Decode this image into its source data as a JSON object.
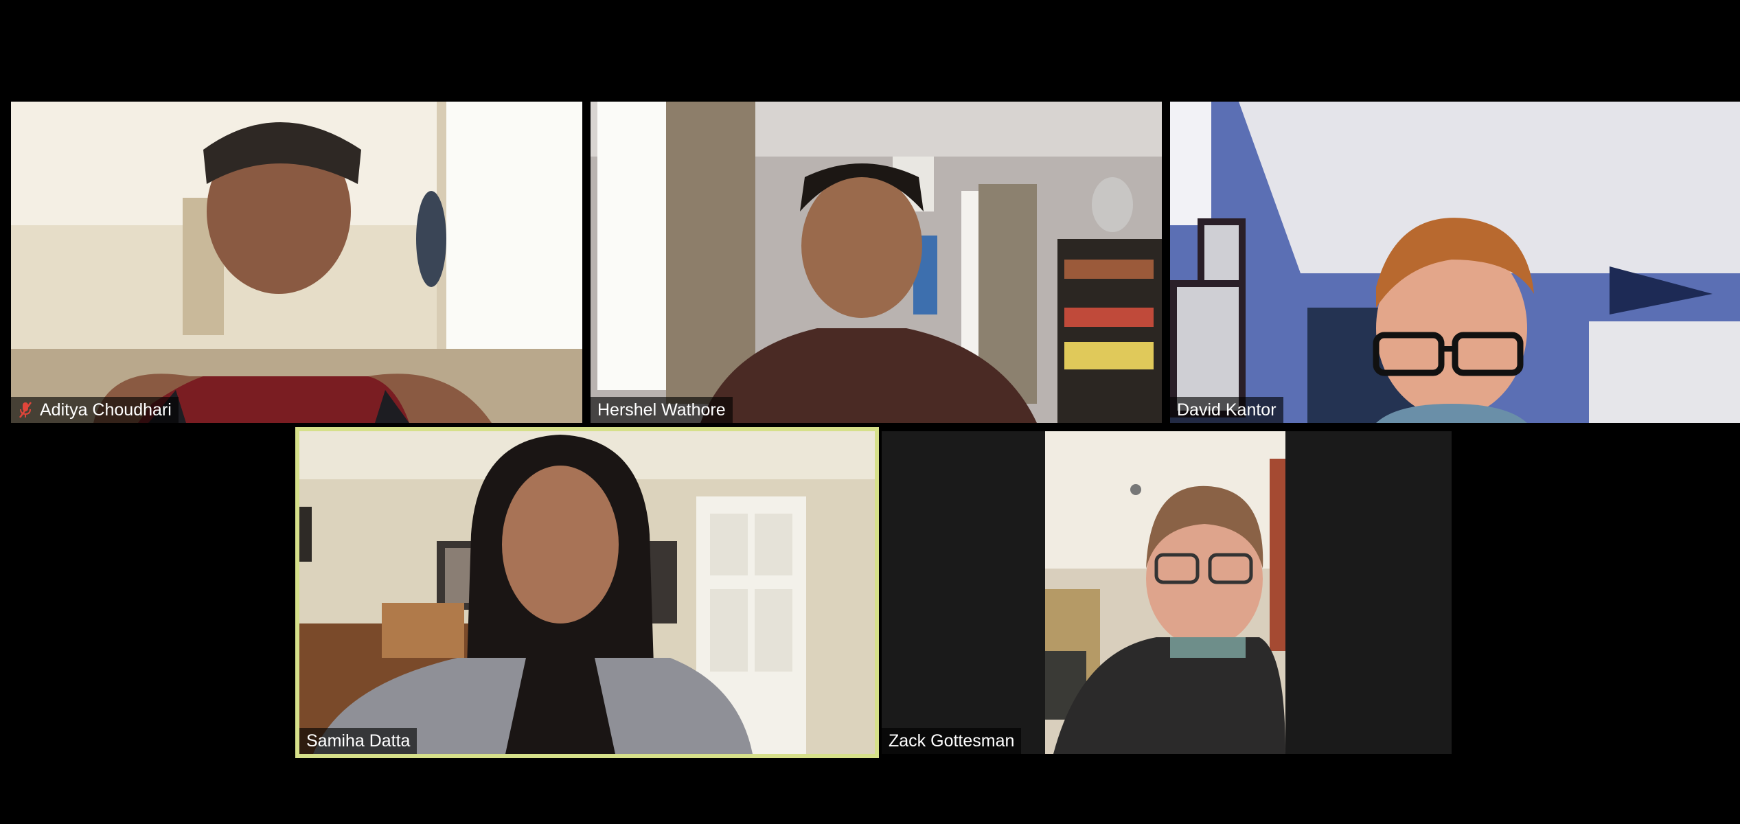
{
  "participants": [
    {
      "name": "Aditya Choudhari",
      "muted": true,
      "icon": "muted-microphone-icon"
    },
    {
      "name": "Hershel Wathore",
      "muted": false
    },
    {
      "name": "David Kantor",
      "muted": false
    },
    {
      "name": "Samiha Datta",
      "muted": false,
      "active_speaker": true
    },
    {
      "name": "Zack Gottesman",
      "muted": false
    }
  ],
  "colors": {
    "background": "#000000",
    "active_speaker_border": "#d6e08a",
    "mute_icon": "#e0453a",
    "tile_placeholder": "#1a1a1a"
  }
}
